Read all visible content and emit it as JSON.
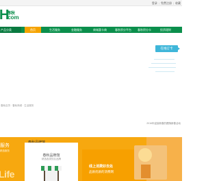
{
  "topbar": {
    "links": [
      "登录",
      "|",
      "免费注册",
      "|",
      "收藏"
    ]
  },
  "logo": {
    "letter": "H",
    "cn": "春秋",
    "com": ".com"
  },
  "nav": {
    "first": "产品分类",
    "items": [
      "首页",
      "生活服务",
      "金融服务",
      "商城惠卡商",
      "春秋积分平台",
      "春秋积分卡",
      "投资理财"
    ]
  },
  "search": {
    "button": "在线订卡"
  },
  "note": "春秋百货 · 春秋商城 · 生活服务",
  "copyright": "2016年迎接新春的跟随新春活动",
  "band": {
    "title": "春秋品牌馆",
    "left_title": "服务",
    "left_sub": "精选服务",
    "life": "Life",
    "card_name": "春秋品牌馆",
    "card_sub": "精选各类知名品牌",
    "promo_line1": "线上消费好去处",
    "promo_line2": "品质优质的消费网"
  },
  "colors": {
    "brand_green": "#0b8f4c",
    "accent_orange": "#f7a80f",
    "button_blue": "#3fb6d9"
  }
}
